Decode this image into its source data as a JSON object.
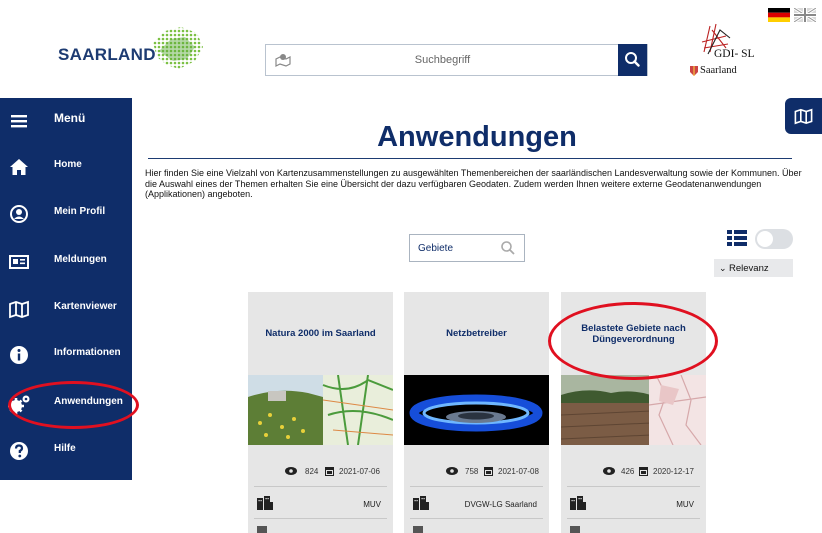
{
  "header": {
    "logo_text": "SAARLAND",
    "search_placeholder": "Suchbegriff",
    "gdi_text": "GDI- SL",
    "gdi_sub": "Saarland",
    "languages": [
      "de",
      "en"
    ]
  },
  "sidebar": {
    "menu_label": "Menü",
    "items": [
      {
        "label": "Home",
        "icon": "home-icon"
      },
      {
        "label": "Mein Profil",
        "icon": "user-icon"
      },
      {
        "label": "Meldungen",
        "icon": "newspaper-icon"
      },
      {
        "label": "Kartenviewer",
        "icon": "map-icon"
      },
      {
        "label": "Informationen",
        "icon": "info-icon"
      },
      {
        "label": "Anwendungen",
        "icon": "gears-icon"
      },
      {
        "label": "Hilfe",
        "icon": "help-icon"
      }
    ]
  },
  "main": {
    "title": "Anwendungen",
    "intro": "Hier finden Sie eine Vielzahl von Kartenzusammenstellungen zu ausgewählten Themenbereichen der saarländischen Landesverwaltung sowie der Kommunen. Über die Auswahl eines der Themen erhalten Sie eine Übersicht der dazu verfügbaren Geodaten. Zudem werden Ihnen weitere externe Geodatenanwendungen (Applikationen) angeboten.",
    "filter_placeholder": "Gebiete",
    "sort_label": "Relevanz"
  },
  "cards": [
    {
      "title": "Natura 2000 im Saarland",
      "views": "824",
      "date": "2021-07-06",
      "org": "MUV"
    },
    {
      "title": "Netzbetreiber",
      "views": "758",
      "date": "2021-07-08",
      "org": "DVGW-LG Saarland"
    },
    {
      "title": "Belastete Gebiete nach Düngeverordnung",
      "views": "426",
      "date": "2020-12-17",
      "org": "MUV"
    }
  ],
  "colors": {
    "brand": "#0f2d69",
    "highlight": "#e01020"
  }
}
